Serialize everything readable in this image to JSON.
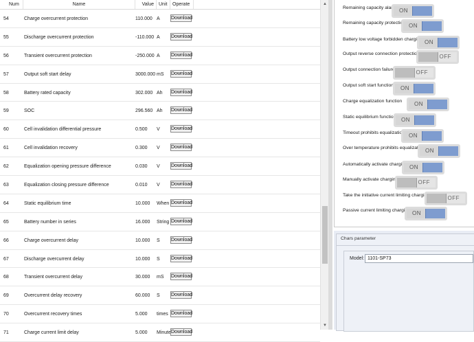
{
  "table": {
    "headers": {
      "num": "Num",
      "name": "Name",
      "value": "Value",
      "unit": "Unit",
      "operate": "Operate"
    },
    "button_label": "Download",
    "rows": [
      {
        "num": "54",
        "name": "Charge overcurrent protection",
        "value": "110.000",
        "unit": "A"
      },
      {
        "num": "55",
        "name": "Discharge overcurrent protection",
        "value": "-110.000",
        "unit": "A"
      },
      {
        "num": "56",
        "name": "Transient overcurrent protection",
        "value": "-250.000",
        "unit": "A"
      },
      {
        "num": "57",
        "name": "Output soft start delay",
        "value": "3000.000",
        "unit": "mS"
      },
      {
        "num": "58",
        "name": "Battery rated capacity",
        "value": "302.000",
        "unit": "Ah"
      },
      {
        "num": "59",
        "name": "SOC",
        "value": "296.560",
        "unit": "Ah"
      },
      {
        "num": "60",
        "name": "Cell invalidation differential pressure",
        "value": "0.500",
        "unit": "V"
      },
      {
        "num": "61",
        "name": "Cell invalidation recovery",
        "value": "0.300",
        "unit": "V"
      },
      {
        "num": "62",
        "name": "Equalization opening pressure difference",
        "value": "0.030",
        "unit": "V"
      },
      {
        "num": "63",
        "name": "Equalization closing pressure difference",
        "value": "0.010",
        "unit": "V"
      },
      {
        "num": "64",
        "name": "Static equilibrium time",
        "value": "10.000",
        "unit": "When"
      },
      {
        "num": "65",
        "name": "Battery number in series",
        "value": "16.000",
        "unit": "String"
      },
      {
        "num": "66",
        "name": "Charge overcurrent delay",
        "value": "10.000",
        "unit": "S"
      },
      {
        "num": "67",
        "name": "Discharge overcurrent delay",
        "value": "10.000",
        "unit": "S"
      },
      {
        "num": "68",
        "name": "Transient overcurrent delay",
        "value": "30.000",
        "unit": "mS"
      },
      {
        "num": "69",
        "name": "Overcurrent delay recovery",
        "value": "60.000",
        "unit": "S"
      },
      {
        "num": "70",
        "name": "Overcurrent recovery times",
        "value": "5.000",
        "unit": "times"
      },
      {
        "num": "71",
        "name": "Charge current limit delay",
        "value": "5.000",
        "unit": "Minute"
      }
    ]
  },
  "switches": [
    {
      "label": "Remaining capacity alarm",
      "state": "ON"
    },
    {
      "label": "Remaining capacity protection",
      "state": "ON"
    },
    {
      "label": "Battery low voltage forbidden charging",
      "state": "ON"
    },
    {
      "label": "Output reverse connection protection",
      "state": "OFF"
    },
    {
      "label": "Output connection failure",
      "state": "OFF"
    },
    {
      "label": "Output soft start function",
      "state": "ON"
    },
    {
      "label": "Charge equalization function",
      "state": "ON"
    },
    {
      "label": "Static equilibrium function",
      "state": "ON"
    },
    {
      "label": "Timeout prohibits equalization",
      "state": "ON"
    },
    {
      "label": "Over temperature prohibits equalization",
      "state": "ON"
    },
    {
      "label": "Automatically activate charging",
      "state": "ON"
    },
    {
      "label": "Manually activate charging",
      "state": "OFF"
    },
    {
      "label": "Take the initiative current limiting charging",
      "state": "OFF"
    },
    {
      "label": "Passive current limiting charging",
      "state": "ON"
    }
  ],
  "chars": {
    "title": "Chars parameter",
    "model_label": "Model:",
    "model_value": "1101-SP73"
  },
  "colors": {
    "toggle_on": "#7e9ccf",
    "toggle_off": "#bdbdbd",
    "panel_bg": "#e8ecf4"
  }
}
